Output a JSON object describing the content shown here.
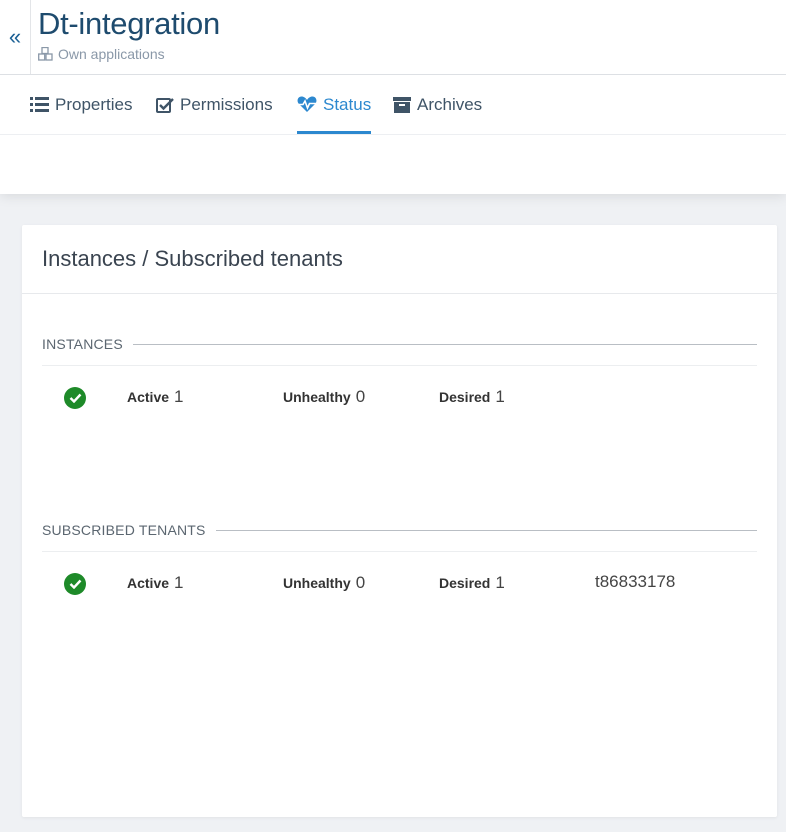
{
  "header": {
    "back_glyph": "«",
    "title": "Dt-integration",
    "subtitle": "Own applications",
    "subtitle_icon": "cubes-icon"
  },
  "tabs": [
    {
      "label": "Properties",
      "icon": "list-icon",
      "active": false
    },
    {
      "label": "Permissions",
      "icon": "checkbox-icon",
      "active": false
    },
    {
      "label": "Status",
      "icon": "heartbeat-icon",
      "active": true
    },
    {
      "label": "Archives",
      "icon": "archive-icon",
      "active": false
    }
  ],
  "card": {
    "title": "Instances / Subscribed tenants"
  },
  "instances": {
    "heading": "INSTANCES",
    "active_label": "Active",
    "active_value": "1",
    "unhealthy_label": "Unhealthy",
    "unhealthy_value": "0",
    "desired_label": "Desired",
    "desired_value": "1"
  },
  "tenants": {
    "heading": "SUBSCRIBED TENANTS",
    "active_label": "Active",
    "active_value": "1",
    "unhealthy_label": "Unhealthy",
    "unhealthy_value": "0",
    "desired_label": "Desired",
    "desired_value": "1",
    "tenant_id": "t86833178"
  },
  "colors": {
    "accent": "#2c88cf",
    "title": "#1e4b6e",
    "healthy": "#1e8a29"
  }
}
